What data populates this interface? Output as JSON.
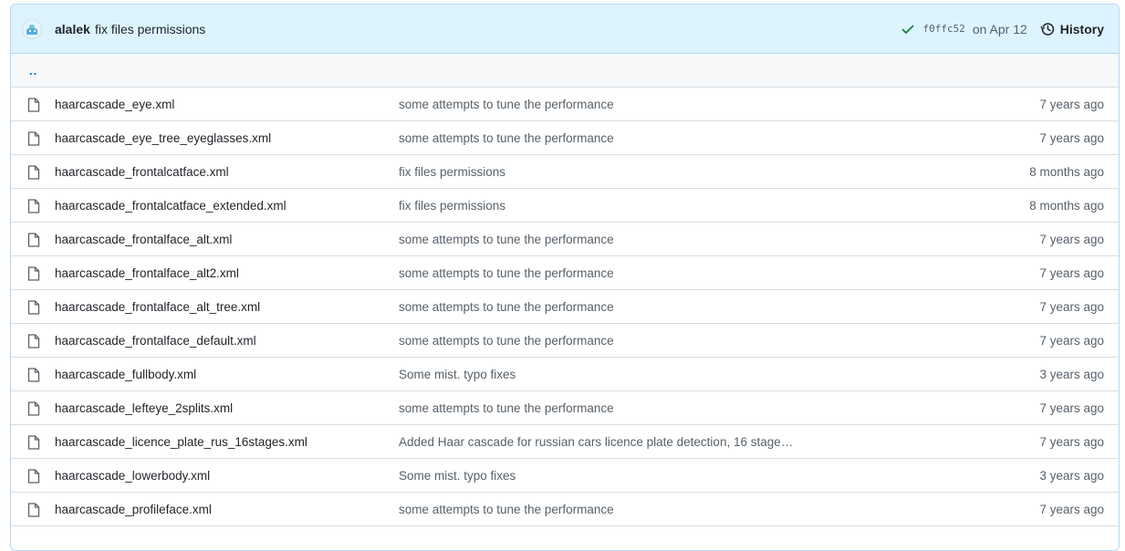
{
  "latest_commit": {
    "author": "alalek",
    "message": "fix files permissions",
    "sha": "f0ffc52",
    "date": "on Apr 12",
    "history_label": "History"
  },
  "parent_dir_label": "..",
  "files": [
    {
      "name": "haarcascade_eye.xml",
      "message": "some attempts to tune the performance",
      "age": "7 years ago"
    },
    {
      "name": "haarcascade_eye_tree_eyeglasses.xml",
      "message": "some attempts to tune the performance",
      "age": "7 years ago"
    },
    {
      "name": "haarcascade_frontalcatface.xml",
      "message": "fix files permissions",
      "age": "8 months ago"
    },
    {
      "name": "haarcascade_frontalcatface_extended.xml",
      "message": "fix files permissions",
      "age": "8 months ago"
    },
    {
      "name": "haarcascade_frontalface_alt.xml",
      "message": "some attempts to tune the performance",
      "age": "7 years ago"
    },
    {
      "name": "haarcascade_frontalface_alt2.xml",
      "message": "some attempts to tune the performance",
      "age": "7 years ago"
    },
    {
      "name": "haarcascade_frontalface_alt_tree.xml",
      "message": "some attempts to tune the performance",
      "age": "7 years ago"
    },
    {
      "name": "haarcascade_frontalface_default.xml",
      "message": "some attempts to tune the performance",
      "age": "7 years ago"
    },
    {
      "name": "haarcascade_fullbody.xml",
      "message": "Some mist. typo fixes",
      "age": "3 years ago"
    },
    {
      "name": "haarcascade_lefteye_2splits.xml",
      "message": "some attempts to tune the performance",
      "age": "7 years ago"
    },
    {
      "name": "haarcascade_licence_plate_rus_16stages.xml",
      "message": "Added Haar cascade for russian cars licence plate detection, 16 stage…",
      "age": "7 years ago"
    },
    {
      "name": "haarcascade_lowerbody.xml",
      "message": "Some mist. typo fixes",
      "age": "3 years ago"
    },
    {
      "name": "haarcascade_profileface.xml",
      "message": "some attempts to tune the performance",
      "age": "7 years ago"
    }
  ],
  "colors": {
    "header_bg": "#ddf4ff",
    "link_blue": "#0969da",
    "check_green": "#1a7f37",
    "muted_text": "#57606a"
  },
  "icons": {
    "commit_status": "check-icon",
    "history": "history-icon",
    "file": "file-icon"
  }
}
